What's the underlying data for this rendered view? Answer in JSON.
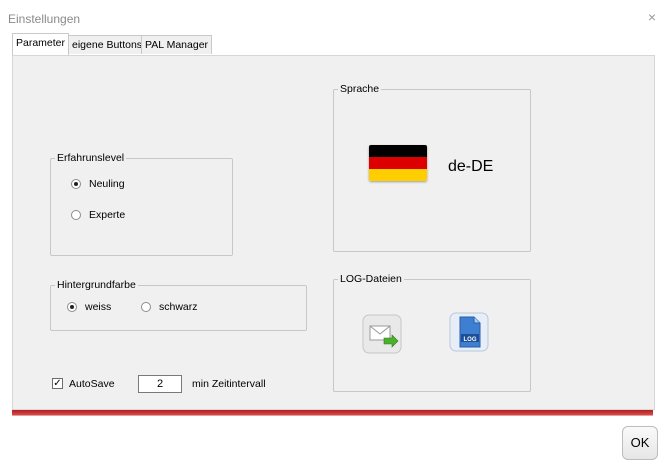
{
  "window": {
    "title": "Einstellungen",
    "close_glyph": "×"
  },
  "tabs": [
    {
      "label": "Parameter",
      "active": true
    },
    {
      "label": "eigene Buttons",
      "active": false
    },
    {
      "label": "PAL Manager",
      "active": false
    }
  ],
  "erfahrung": {
    "legend": "Erfahrunslevel",
    "options": [
      {
        "label": "Neuling",
        "selected": true
      },
      {
        "label": "Experte",
        "selected": false
      }
    ]
  },
  "hintergrund": {
    "legend": "Hintergrundfarbe",
    "options": [
      {
        "label": "weiss",
        "selected": true
      },
      {
        "label": "schwarz",
        "selected": false
      }
    ]
  },
  "autosave": {
    "label": "AutoSave",
    "checked": true,
    "check_glyph": "✓",
    "interval_value": "2",
    "unit_label": "min Zeitintervall"
  },
  "sprache": {
    "legend": "Sprache",
    "language_code": "de-DE",
    "flag_colors": [
      "#000000",
      "#dd0000",
      "#ffce00"
    ]
  },
  "log": {
    "legend": "LOG-Dateien",
    "mail_icon": "mail-send-icon",
    "log_icon": "log-file-icon",
    "log_icon_text": "LOG"
  },
  "footer": {
    "ok_label": "OK",
    "accent_color": "#c0282a"
  }
}
